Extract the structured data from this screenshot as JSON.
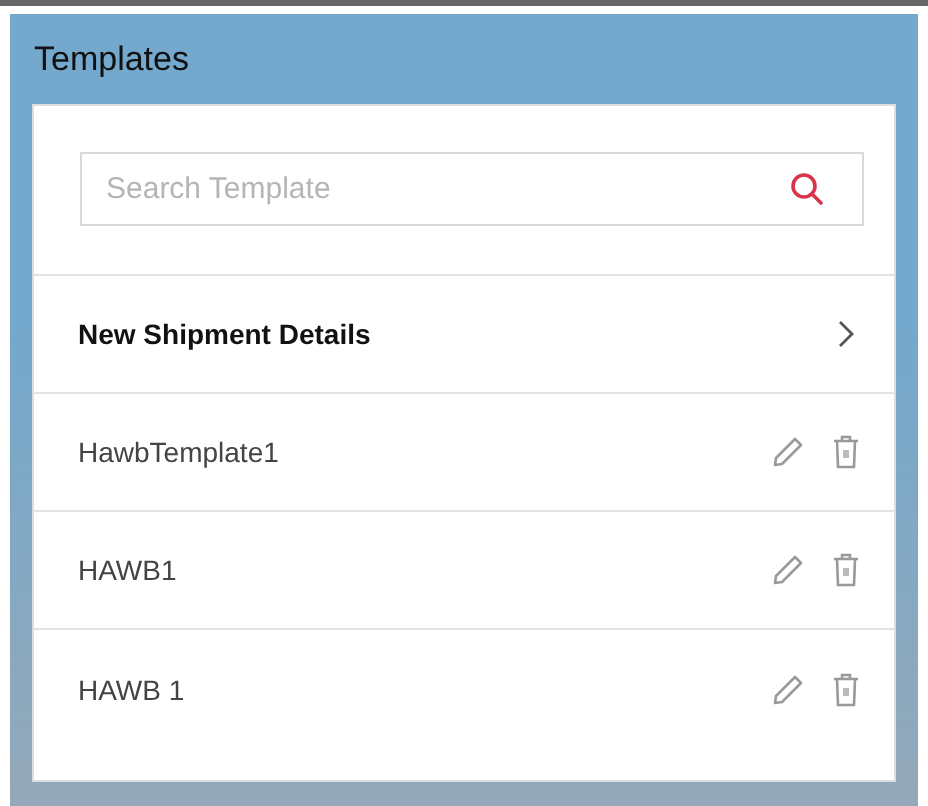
{
  "panel": {
    "title": "Templates"
  },
  "search": {
    "placeholder": "Search Template"
  },
  "items": [
    {
      "kind": "link",
      "label": "New Shipment Details"
    },
    {
      "kind": "template",
      "label": "HawbTemplate1"
    },
    {
      "kind": "template",
      "label": "HAWB1"
    },
    {
      "kind": "template",
      "label": "HAWB 1"
    }
  ]
}
